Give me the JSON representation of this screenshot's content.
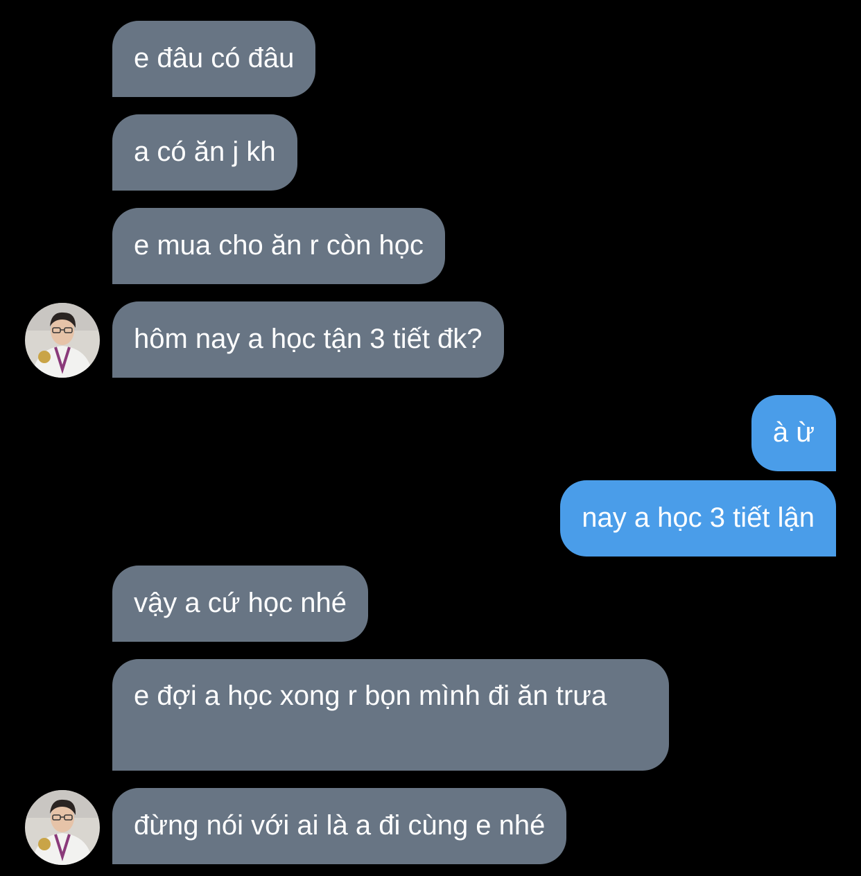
{
  "conversation": {
    "messages": [
      {
        "sender": "other",
        "text": "e đâu có đâu"
      },
      {
        "sender": "other",
        "text": "a có ăn j kh"
      },
      {
        "sender": "other",
        "text": "e mua cho ăn r còn học"
      },
      {
        "sender": "other",
        "text": "hôm nay a học tận 3 tiết đk?"
      },
      {
        "sender": "me",
        "text": "à ừ"
      },
      {
        "sender": "me",
        "text": "nay a học 3 tiết lận"
      },
      {
        "sender": "other",
        "text": "vậy a cứ học nhé"
      },
      {
        "sender": "other",
        "text": "e đợi a học xong r bọn mình đi ăn trưa"
      },
      {
        "sender": "other",
        "text": "đừng nói với ai là a đi cùng e nhé"
      }
    ]
  },
  "colors": {
    "background": "#000000",
    "incoming_bubble": "#687584",
    "outgoing_bubble": "#4a9de9",
    "text": "#ffffff"
  }
}
